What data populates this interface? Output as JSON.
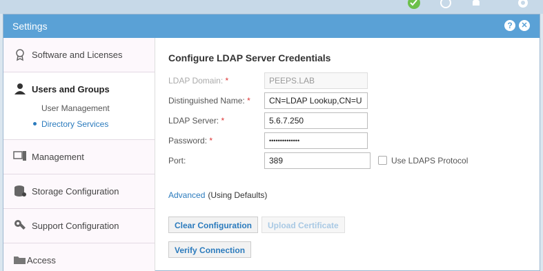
{
  "dialog": {
    "title": "Settings",
    "help_label": "?",
    "close_label": "✕"
  },
  "sidebar": {
    "items": [
      {
        "label": "Software and Licenses",
        "icon": "certificate-icon"
      },
      {
        "label": "Users and Groups",
        "icon": "users-icon",
        "active": true,
        "subitems": [
          {
            "label": "User Management"
          },
          {
            "label": "Directory Services",
            "active": true
          }
        ]
      },
      {
        "label": "Management",
        "icon": "management-icon"
      },
      {
        "label": "Storage Configuration",
        "icon": "storage-icon"
      },
      {
        "label": "Support Configuration",
        "icon": "wrench-icon"
      },
      {
        "label": "Access",
        "icon": "folder-icon"
      }
    ]
  },
  "main": {
    "heading": "Configure LDAP Server Credentials",
    "fields": {
      "ldap_domain": {
        "label": "LDAP Domain:",
        "required": "*",
        "value": "PEEPS.LAB"
      },
      "dn": {
        "label": "Distinguished Name:",
        "required": "*",
        "value": "CN=LDAP Lookup,CN=U"
      },
      "server": {
        "label": "LDAP Server:",
        "required": "*",
        "value": "5.6.7.250"
      },
      "password": {
        "label": "Password:",
        "required": "*",
        "value": "••••••••••••••"
      },
      "port": {
        "label": "Port:",
        "value": "389"
      }
    },
    "ldaps": {
      "label": "Use LDAPS Protocol",
      "checked": false
    },
    "advanced": {
      "link": "Advanced",
      "note": "(Using Defaults)"
    },
    "buttons": {
      "clear": "Clear Configuration",
      "upload": "Upload Certificate",
      "verify": "Verify Connection"
    }
  },
  "colors": {
    "titlebar": "#5aa1d6",
    "link": "#2b7bbd",
    "required": "#d33333"
  }
}
